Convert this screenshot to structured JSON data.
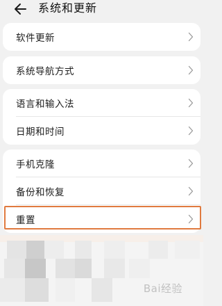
{
  "header": {
    "title": "系统和更新"
  },
  "groups": [
    {
      "items": [
        {
          "label": "软件更新"
        }
      ]
    },
    {
      "items": [
        {
          "label": "系统导航方式"
        }
      ]
    },
    {
      "items": [
        {
          "label": "语言和输入法"
        },
        {
          "label": "日期和时间"
        }
      ]
    },
    {
      "items": [
        {
          "label": "手机克隆"
        },
        {
          "label": "备份和恢复"
        },
        {
          "label": "重置"
        }
      ]
    }
  ],
  "highlight_color": "#e07a3f",
  "watermark": "Bai经验"
}
